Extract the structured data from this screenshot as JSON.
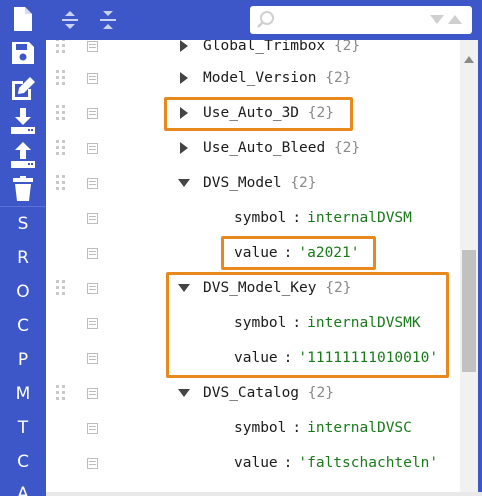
{
  "toolbar_left": {
    "buttons": [
      {
        "name": "new-document-icon"
      },
      {
        "name": "save-icon"
      },
      {
        "name": "edit-icon"
      },
      {
        "name": "download-icon"
      },
      {
        "name": "upload-icon"
      },
      {
        "name": "trash-icon"
      }
    ],
    "nav_letters": [
      "S",
      "R",
      "O",
      "C",
      "P",
      "M",
      "T",
      "C",
      "A"
    ]
  },
  "toolbar_top": {
    "expand_all_icon": "expand-all-icon",
    "collapse_all_icon": "collapse-all-icon",
    "search": {
      "placeholder": "",
      "value": ""
    }
  },
  "tree": {
    "rows": [
      {
        "type": "node",
        "key": "Global_Trimbox",
        "count": "{2}",
        "expanded": false
      },
      {
        "type": "node",
        "key": "Model_Version",
        "count": "{2}",
        "expanded": false
      },
      {
        "type": "node",
        "key": "Use_Auto_3D",
        "count": "{2}",
        "expanded": false,
        "highlighted": true
      },
      {
        "type": "node",
        "key": "Use_Auto_Bleed",
        "count": "{2}",
        "expanded": false
      },
      {
        "type": "node",
        "key": "DVS_Model",
        "count": "{2}",
        "expanded": true
      },
      {
        "type": "prop",
        "key": "symbol",
        "sep": ":",
        "value": "internalDVSM"
      },
      {
        "type": "prop",
        "key": "value",
        "sep": ":",
        "value": "'a2021'",
        "highlighted": true
      },
      {
        "type": "node",
        "key": "DVS_Model_Key",
        "count": "{2}",
        "expanded": true,
        "highlighted": true
      },
      {
        "type": "prop",
        "key": "symbol",
        "sep": ":",
        "value": "internalDVSMK"
      },
      {
        "type": "prop",
        "key": "value",
        "sep": ":",
        "value": "'11111111010010'"
      },
      {
        "type": "node",
        "key": "DVS_Catalog",
        "count": "{2}",
        "expanded": true
      },
      {
        "type": "prop",
        "key": "symbol",
        "sep": ":",
        "value": "internalDVSC"
      },
      {
        "type": "prop",
        "key": "value",
        "sep": ":",
        "value": "'faltschachteln'"
      }
    ]
  },
  "colors": {
    "toolbar": "#3d57c9",
    "highlight": "#e8891d",
    "value_text": "#1a7a1a",
    "count_text": "#8a8a8a"
  }
}
